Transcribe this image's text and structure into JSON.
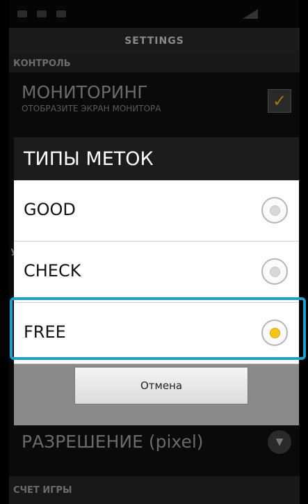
{
  "header": {
    "title": "SETTINGS"
  },
  "sections": {
    "control": "КОНТРОЛЬ",
    "score": "СЧЕТ ИГРЫ",
    "partial": "У"
  },
  "background": {
    "monitoring_title": "МОНИТОРИНГ",
    "monitoring_sub": "ОТОБРАЗИТЕ ЭКРАН МОНИТОРА",
    "monitoring_checked": true,
    "resolution_label": "РАЗРЕШЕНИЕ (pixel)"
  },
  "dialog": {
    "title": "ТИПЫ МЕТОК",
    "options": [
      {
        "label": "GOOD",
        "selected": false
      },
      {
        "label": "CHECK",
        "selected": false
      },
      {
        "label": "FREE",
        "selected": true
      }
    ],
    "cancel_label": "Отмена"
  },
  "colors": {
    "highlight": "#1e9fd0",
    "radio_selected": "#f7c419"
  },
  "icons": [
    "checkbox-icon",
    "dropdown-icon",
    "radio-icon"
  ]
}
